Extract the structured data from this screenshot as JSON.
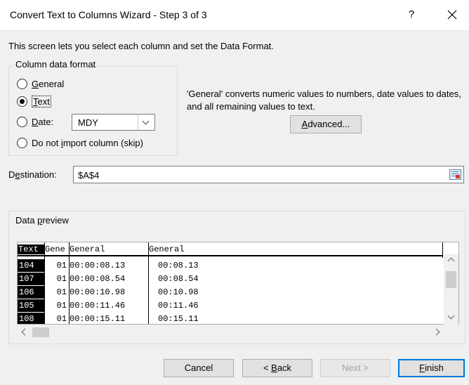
{
  "window": {
    "title": "Convert Text to Columns Wizard - Step 3 of 3",
    "help_glyph": "?",
    "close_glyph": "✕"
  },
  "intro": "This screen lets you select each column and set the Data Format.",
  "format_group": {
    "legend": "Column data format",
    "general": {
      "pre": "",
      "key": "G",
      "post": "eneral"
    },
    "text": {
      "pre": "",
      "key": "T",
      "post": "ext"
    },
    "date": {
      "pre": "",
      "key": "D",
      "post": "ate:"
    },
    "skip": {
      "pre": "Do not ",
      "key": "i",
      "post": "mport column (skip)"
    },
    "selected": "text",
    "date_format": "MDY"
  },
  "description": "'General' converts numeric values to numbers, date values to dates, and all remaining values to text.",
  "advanced_button": {
    "pre": "",
    "key": "A",
    "post": "dvanced..."
  },
  "destination": {
    "label_pre": "D",
    "label_key": "e",
    "label_post": "stination:",
    "value": "$A$4"
  },
  "preview": {
    "legend_pre": "Data ",
    "legend_key": "p",
    "legend_post": "review",
    "headers": [
      "Text",
      "Gene",
      "General",
      "General"
    ],
    "rows": [
      [
        "104",
        "01",
        "00:00:08.13",
        "00:08.13"
      ],
      [
        "107",
        "01",
        "00:00:08.54",
        "00:08.54"
      ],
      [
        "106",
        "01",
        "00:00:10.98",
        "00:10.98"
      ],
      [
        "105",
        "01",
        "00:00:11.46",
        "00:11.46"
      ],
      [
        "108",
        "01",
        "00:00:15.11",
        "00:15.11"
      ]
    ]
  },
  "buttons": {
    "cancel": "Cancel",
    "back": {
      "pre": "< ",
      "key": "B",
      "post": "ack"
    },
    "next": "Next >",
    "finish": {
      "pre": "",
      "key": "F",
      "post": "inish"
    }
  }
}
